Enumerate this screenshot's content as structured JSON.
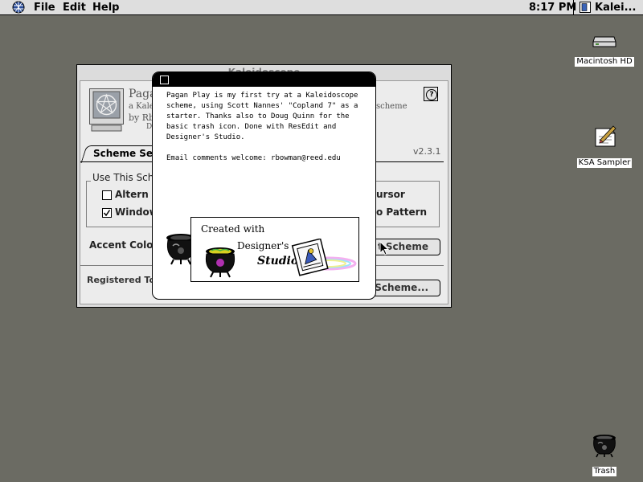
{
  "menubar": {
    "items": [
      "File",
      "Edit",
      "Help"
    ],
    "clock": "8:17 PM",
    "active_app": "Kalei..."
  },
  "desktop": {
    "icons": [
      {
        "label": "Macintosh HD",
        "icon": "hard-drive-icon"
      },
      {
        "label": "KSA Sampler",
        "icon": "document-icon"
      },
      {
        "label": "Trash",
        "icon": "trash-cauldron-icon"
      }
    ]
  },
  "kaleidoscope": {
    "title": "Kaleidoscope",
    "scheme_name_partial": "Paga",
    "scheme_desc_partial": "a Kalei",
    "scheme_desc_suffix": "scheme",
    "author_partial": "by Rb",
    "author_line2_partial": "D",
    "version": "v2.3.1",
    "help_label": "?",
    "tab_label": "Scheme Set",
    "group_label": "Use This Sch",
    "checkboxes": [
      {
        "label": "Altern",
        "checked": false
      },
      {
        "label": "Window",
        "checked": true
      }
    ],
    "right_labels": [
      "ursor",
      "o Pattern"
    ],
    "accent_label": "Accent Colo",
    "scheme_button": "t Scheme",
    "registered_label": "Registered To:",
    "select_button": "t Scheme..."
  },
  "dialog": {
    "paragraph1": "Pagan Play is my first try at a Kaleidoscope scheme, using Scott Nannes' \"Copland 7\" as a starter.  Thanks also to Doug Quinn for the basic trash icon.  Done with ResEdit and Designer's Studio.",
    "paragraph2": "Email comments welcome: rbowman@reed.edu",
    "credit": {
      "line1": "Created with",
      "line2": "Designer's",
      "line3": "Studio"
    }
  },
  "colors": {
    "desktop": "#6b6b63",
    "menubar": "#dedede",
    "window": "#dcdcdc",
    "dialog_title": "#000000"
  }
}
